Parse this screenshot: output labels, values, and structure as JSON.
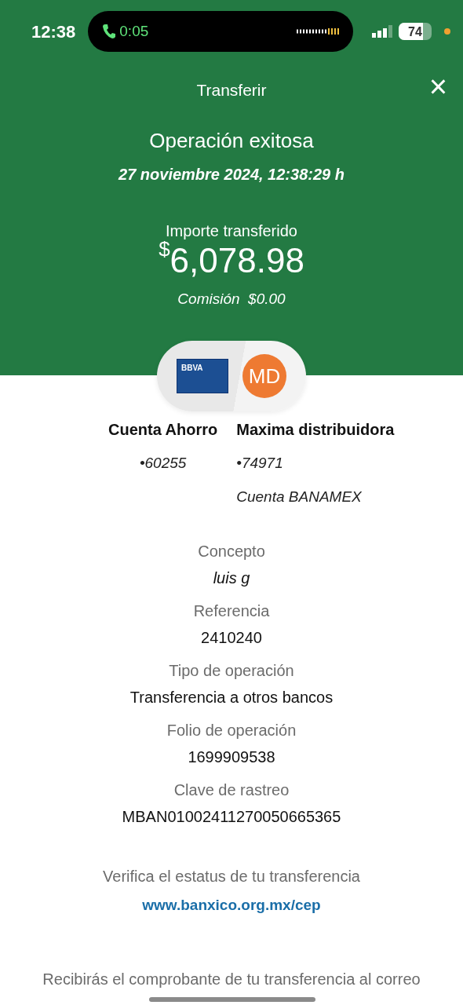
{
  "status_bar": {
    "time": "12:38",
    "call_timer": "0:05",
    "battery": "74"
  },
  "header": {
    "title": "Transferir",
    "close": "×"
  },
  "result": {
    "title": "Operación exitosa",
    "datetime": "27 noviembre 2024, 12:38:29 h",
    "amount_label": "Importe transferido",
    "currency": "$",
    "amount": "6,078.98",
    "fee_label": "Comisión",
    "fee": "$0.00"
  },
  "parties": {
    "source_card_label": "BBVA",
    "recipient_initials": "MD",
    "source": {
      "name": "Cuenta Ahorro",
      "account": "•60255"
    },
    "recipient": {
      "name": "Maxima distribuidora",
      "account": "•74971",
      "bank": "Cuenta BANAMEX"
    }
  },
  "details": [
    {
      "label": "Concepto",
      "value": "luis g",
      "italic": true
    },
    {
      "label": "Referencia",
      "value": "2410240",
      "italic": false
    },
    {
      "label": "Tipo de operación",
      "value": "Transferencia a otros bancos",
      "italic": false
    },
    {
      "label": "Folio de operación",
      "value": "1699909538",
      "italic": false
    },
    {
      "label": "Clave de rastreo",
      "value": "MBAN01002411270050665365",
      "italic": false
    }
  ],
  "verify": {
    "text": "Verifica el estatus de tu transferencia",
    "link": "www.banxico.org.mx/cep"
  },
  "footer_text": "Recibirás el comprobante de tu transferencia al correo"
}
